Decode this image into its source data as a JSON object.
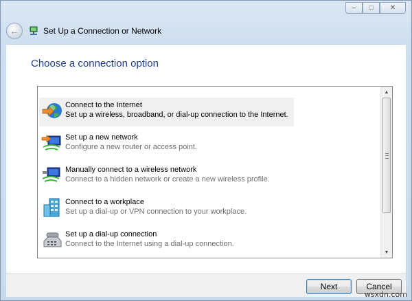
{
  "window": {
    "title": "Set Up a Connection or Network",
    "controls": {
      "minimize": "–",
      "maximize": "□",
      "close": "✕"
    }
  },
  "page": {
    "heading": "Choose a connection option"
  },
  "options": [
    {
      "name": "Connect to the Internet",
      "description": "Set up a wireless, broadband, or dial-up connection to the Internet.",
      "icon": "globe-icon"
    },
    {
      "name": "Set up a new network",
      "description": "Configure a new router or access point.",
      "icon": "new-network-icon"
    },
    {
      "name": "Manually connect to a wireless network",
      "description": "Connect to a hidden network or create a new wireless profile.",
      "icon": "wireless-network-icon"
    },
    {
      "name": "Connect to a workplace",
      "description": "Set up a dial-up or VPN connection to your workplace.",
      "icon": "workplace-icon"
    },
    {
      "name": "Set up a dial-up connection",
      "description": "Connect to the Internet using a dial-up connection.",
      "icon": "dialup-phone-icon"
    }
  ],
  "buttons": {
    "next": "Next",
    "cancel": "Cancel"
  },
  "watermark": "wsxdn.com",
  "colors": {
    "heading": "#1e3f8a",
    "selection": "#f0f0f0",
    "accent_button": "#3c7fb1"
  }
}
